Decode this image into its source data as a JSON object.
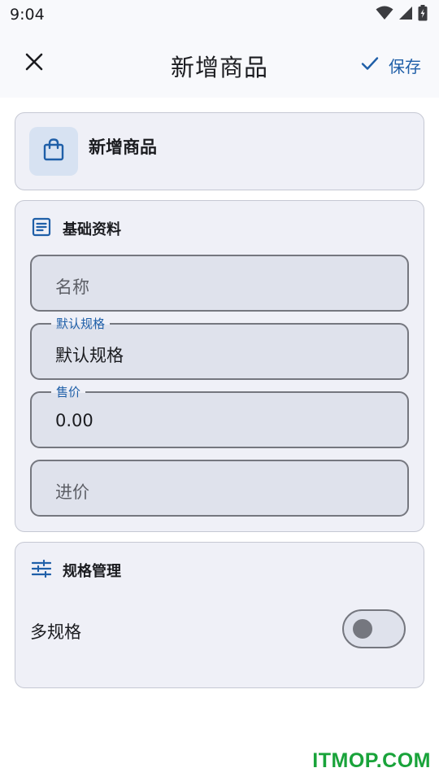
{
  "status_bar": {
    "time": "9:04",
    "icons": [
      "wifi-icon",
      "signal-icon",
      "battery-icon"
    ]
  },
  "app_bar": {
    "close_icon": "close-icon",
    "title": "新增商品",
    "save_label": "保存",
    "save_icon": "check-icon"
  },
  "header_card": {
    "icon": "shopping-bag-icon",
    "title": "新增商品"
  },
  "basic_info": {
    "icon": "article-icon",
    "title": "基础资料",
    "fields": {
      "name": {
        "placeholder": "名称",
        "value": ""
      },
      "spec": {
        "label": "默认规格",
        "value": "默认规格"
      },
      "price": {
        "label": "售价",
        "value": "0.00"
      },
      "cost": {
        "placeholder": "进价",
        "value": ""
      }
    }
  },
  "spec_management": {
    "icon": "tune-icon",
    "title": "规格管理",
    "multi_spec_label": "多规格",
    "multi_spec_enabled": false
  },
  "colors": {
    "accent": "#1f5fa8",
    "card_bg": "#eff0f7",
    "field_bg": "#dfe2ec",
    "outline": "#75777f"
  },
  "watermark": "ITMOP.COM"
}
